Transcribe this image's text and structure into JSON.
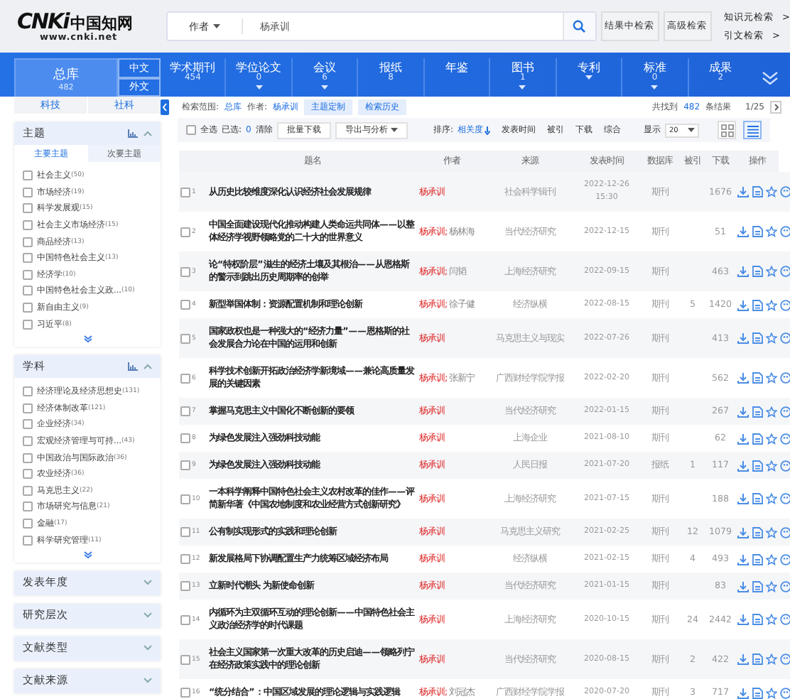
{
  "header": {
    "logo_mark": "CNKi",
    "logo_text": "中国知网",
    "logo_url": "www.cnki.net",
    "search_scope": "作者",
    "search_value": "杨承训",
    "buttons": [
      "结果中检索",
      "高级检索"
    ],
    "links": [
      {
        "label": "知识元检索",
        "arrow": ">"
      },
      {
        "label": "引文检索",
        "arrow": ">"
      }
    ]
  },
  "nav": {
    "total": {
      "label": "总库",
      "count": "482",
      "selected": true
    },
    "languages": [
      {
        "label": "中文",
        "selected": false
      },
      {
        "label": "外文",
        "selected": false
      }
    ],
    "items": [
      {
        "label": "学术期刊",
        "count": "454",
        "dropdown": false
      },
      {
        "label": "学位论文",
        "count": "0",
        "dropdown": true
      },
      {
        "label": "会议",
        "count": "6",
        "dropdown": true
      },
      {
        "label": "报纸",
        "count": "8",
        "dropdown": false
      },
      {
        "label": "年鉴",
        "dropdown": false
      },
      {
        "label": "图书",
        "count": "1",
        "dropdown": true
      },
      {
        "label": "专利",
        "dropdown": true
      },
      {
        "label": "标准",
        "count": "0",
        "dropdown": true
      },
      {
        "label": "成果",
        "count": "2",
        "dropdown": false
      }
    ]
  },
  "sidebar": {
    "discipline_tabs": [
      {
        "label": "科技",
        "selected": false
      },
      {
        "label": "社科",
        "selected": false
      }
    ],
    "facets": [
      {
        "title": "主题",
        "expanded": true,
        "subtabs": [
          {
            "label": "主要主题",
            "selected": true
          },
          {
            "label": "次要主题",
            "selected": false
          }
        ],
        "items": [
          {
            "label": "社会主义",
            "count": "(50)",
            "checked": false
          },
          {
            "label": "市场经济",
            "count": "(19)",
            "checked": false
          },
          {
            "label": "科学发展观",
            "count": "(15)",
            "checked": false
          },
          {
            "label": "社会主义市场经济",
            "count": "(15)",
            "checked": false
          },
          {
            "label": "商品经济",
            "count": "(13)",
            "checked": false
          },
          {
            "label": "中国特色社会主义",
            "count": "(13)",
            "checked": false
          },
          {
            "label": "经济学",
            "count": "(10)",
            "checked": false
          },
          {
            "label": "中国特色社会主义政...",
            "count": "(10)",
            "checked": false
          },
          {
            "label": "新自由主义",
            "count": "(9)",
            "checked": false
          },
          {
            "label": "习近平",
            "count": "(8)",
            "checked": false
          }
        ]
      },
      {
        "title": "学科",
        "expanded": true,
        "items": [
          {
            "label": "经济理论及经济思想史",
            "count": "(131)",
            "checked": false
          },
          {
            "label": "经济体制改革",
            "count": "(121)",
            "checked": false
          },
          {
            "label": "企业经济",
            "count": "(34)",
            "checked": false
          },
          {
            "label": "宏观经济管理与可持...",
            "count": "(43)",
            "checked": false
          },
          {
            "label": "中国政治与国际政治",
            "count": "(36)",
            "checked": false
          },
          {
            "label": "农业经济",
            "count": "(36)",
            "checked": false
          },
          {
            "label": "马克思主义",
            "count": "(22)",
            "checked": false
          },
          {
            "label": "市场研究与信息",
            "count": "(21)",
            "checked": false
          },
          {
            "label": "金融",
            "count": "(17)",
            "checked": false
          },
          {
            "label": "科学研究管理",
            "count": "(11)",
            "checked": false
          }
        ]
      },
      {
        "title": "发表年度",
        "expanded": false
      },
      {
        "title": "研究层次",
        "expanded": false
      },
      {
        "title": "文献类型",
        "expanded": false
      },
      {
        "title": "文献来源",
        "expanded": false
      }
    ]
  },
  "results_info": {
    "scope_label": "检索范围:",
    "scope": "总库",
    "author_label": "作者:",
    "author": "杨承训",
    "tags": [
      "主题定制",
      "检索历史"
    ],
    "found_prefix": "共找到",
    "found": "482",
    "found_suffix": "条结果",
    "page": "1/25"
  },
  "toolbar": {
    "select_all": {
      "label": "全选",
      "checked": false
    },
    "selected_label": "已选:",
    "selected_count": "0",
    "clear": "清除",
    "batch": "批量下载",
    "export": "导出与分析",
    "sort_label": "排序:",
    "sorts": [
      {
        "label": "相关度",
        "selected": true
      },
      {
        "label": "发表时间",
        "selected": false
      },
      {
        "label": "被引",
        "selected": false
      },
      {
        "label": "下载",
        "selected": false
      },
      {
        "label": "综合",
        "selected": false
      }
    ],
    "show_label": "显示",
    "page_size": "20",
    "views": [
      {
        "kind": "grid",
        "selected": false
      },
      {
        "kind": "list",
        "selected": true
      }
    ]
  },
  "table": {
    "columns": [
      "题名",
      "作者",
      "来源",
      "发表时间",
      "数据库",
      "被引",
      "下载",
      "操作"
    ],
    "rows": [
      {
        "index": "1",
        "checked": false,
        "title": "从历史比较维度深化认识经济社会发展规律",
        "authors": [
          {
            "name": "杨承训",
            "highlight": true
          }
        ],
        "source": "社会科学辑刊",
        "date": "2022-12-26",
        "time": "15:30",
        "database": "期刊",
        "downloads": "1676"
      },
      {
        "index": "2",
        "checked": false,
        "title": "中国全面建设现代化推动构建人类命运共同体——以整体经济学视野领略党的二十大的世界意义",
        "authors": [
          {
            "name": "杨承训;",
            "highlight": true
          },
          {
            "name": "杨林海",
            "highlight": false
          }
        ],
        "source": "当代经济研究",
        "date": "2022-12-15",
        "database": "期刊",
        "downloads": "51"
      },
      {
        "index": "3",
        "checked": false,
        "title": "论“特权阶层”滋生的经济土壤及其根治——从恩格斯的警示到跳出历史周期率的创举",
        "authors": [
          {
            "name": "杨承训;",
            "highlight": true
          },
          {
            "name": "闫韬",
            "highlight": false
          }
        ],
        "source": "上海经济研究",
        "date": "2022-09-15",
        "database": "期刊",
        "downloads": "463"
      },
      {
        "index": "4",
        "checked": false,
        "title": "新型举国体制：资源配置机制和理论创新",
        "authors": [
          {
            "name": "杨承训;",
            "highlight": true
          },
          {
            "name": "徐子健",
            "highlight": false
          }
        ],
        "source": "经济纵横",
        "date": "2022-08-15",
        "database": "期刊",
        "cited": "5",
        "downloads": "1420"
      },
      {
        "index": "5",
        "checked": false,
        "title": "国家政权也是一种强大的“经济力量”——恩格斯的社会发展合力论在中国的运用和创新",
        "authors": [
          {
            "name": "杨承训",
            "highlight": true
          }
        ],
        "source": "马克思主义与现实",
        "date": "2022-07-26",
        "database": "期刊",
        "downloads": "413"
      },
      {
        "index": "6",
        "checked": false,
        "title": "科学技术创新开拓政治经济学新境域——兼论高质量发展的关键因素",
        "authors": [
          {
            "name": "杨承训;",
            "highlight": true
          },
          {
            "name": "张新宁",
            "highlight": false
          }
        ],
        "source": "广西财经学院学报",
        "date": "2022-02-20",
        "database": "期刊",
        "downloads": "562"
      },
      {
        "index": "7",
        "checked": false,
        "title": "掌握马克思主义中国化不断创新的要领",
        "authors": [
          {
            "name": "杨承训",
            "highlight": true
          }
        ],
        "source": "当代经济研究",
        "date": "2022-01-15",
        "database": "期刊",
        "downloads": "267"
      },
      {
        "index": "8",
        "checked": false,
        "title": "为绿色发展注入强劲科技动能",
        "authors": [
          {
            "name": "杨承训",
            "highlight": true
          }
        ],
        "source": "上海企业",
        "date": "2021-08-10",
        "database": "期刊",
        "downloads": "62"
      },
      {
        "index": "9",
        "checked": false,
        "title": "为绿色发展注入强劲科技动能",
        "authors": [
          {
            "name": "杨承训",
            "highlight": true
          }
        ],
        "source": "人民日报",
        "date": "2021-07-20",
        "database": "报纸",
        "cited": "1",
        "downloads": "117"
      },
      {
        "index": "10",
        "checked": false,
        "title": "一本科学阐释中国特色社会主义农村改革的佳作——评简新华著《中国农地制度和农业经营方式创新研究》",
        "authors": [
          {
            "name": "杨承训",
            "highlight": true
          }
        ],
        "source": "上海经济研究",
        "date": "2021-07-15",
        "database": "期刊",
        "downloads": "188"
      },
      {
        "index": "11",
        "checked": false,
        "title": "公有制实现形式的实践和理论创新",
        "authors": [
          {
            "name": "杨承训",
            "highlight": true
          }
        ],
        "source": "马克思主义研究",
        "date": "2021-02-25",
        "database": "期刊",
        "cited": "12",
        "downloads": "1079"
      },
      {
        "index": "12",
        "checked": false,
        "title": "新发展格局下协调配置生产力统筹区域经济布局",
        "authors": [
          {
            "name": "杨承训",
            "highlight": true
          }
        ],
        "source": "经济纵横",
        "date": "2021-02-15",
        "database": "期刊",
        "cited": "4",
        "downloads": "493"
      },
      {
        "index": "13",
        "checked": false,
        "title": "立新时代潮头 为新使命创新",
        "authors": [
          {
            "name": "杨承训",
            "highlight": true
          }
        ],
        "source": "当代经济研究",
        "date": "2021-01-15",
        "database": "期刊",
        "downloads": "83"
      },
      {
        "index": "14",
        "checked": false,
        "title": "内循环为主双循环互动的理论创新——中国特色社会主义政治经济学的时代课题",
        "authors": [
          {
            "name": "杨承训",
            "highlight": true
          }
        ],
        "source": "上海经济研究",
        "date": "2020-10-15",
        "database": "期刊",
        "cited": "24",
        "downloads": "2442"
      },
      {
        "index": "15",
        "checked": false,
        "title": "社会主义国家第一次重大改革的历史启迪——领略列宁在经济政策实践中的理论创新",
        "authors": [
          {
            "name": "杨承训",
            "highlight": true
          }
        ],
        "source": "当代经济研究",
        "date": "2020-08-15",
        "database": "期刊",
        "cited": "2",
        "downloads": "422"
      },
      {
        "index": "16",
        "checked": false,
        "title": "“统分结合”：中国区域发展的理论逻辑与实践逻辑",
        "authors": [
          {
            "name": "杨承训;",
            "highlight": true
          },
          {
            "name": "刘冠杰",
            "highlight": false
          }
        ],
        "source": "广西财经学院学报",
        "date": "2020-07-20",
        "database": "期刊",
        "cited": "3",
        "downloads": "717"
      }
    ]
  }
}
